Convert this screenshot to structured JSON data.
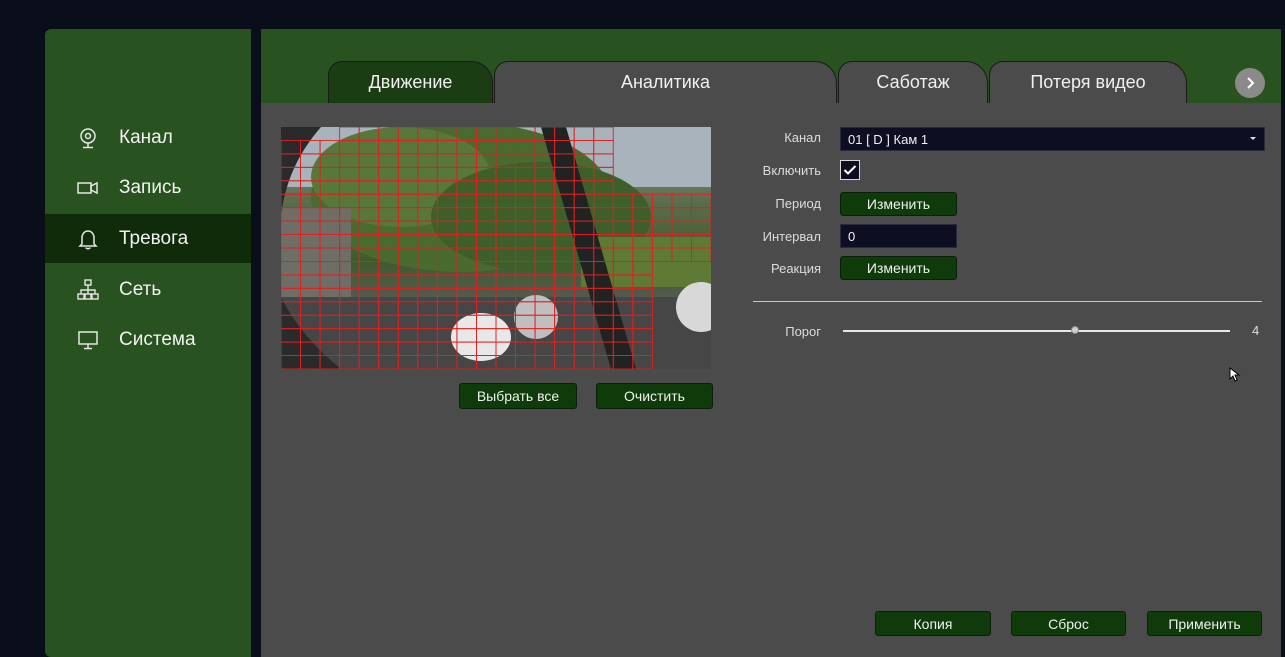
{
  "sidebar": {
    "items": [
      {
        "label": "Канал",
        "icon": "camera-icon",
        "active": false
      },
      {
        "label": "Запись",
        "icon": "video-record-icon",
        "active": false
      },
      {
        "label": "Тревога",
        "icon": "bell-icon",
        "active": true
      },
      {
        "label": "Сеть",
        "icon": "network-icon",
        "active": false
      },
      {
        "label": "Система",
        "icon": "monitor-icon",
        "active": false
      }
    ]
  },
  "tabs": [
    {
      "label": "Движение",
      "active": true
    },
    {
      "label": "Аналитика",
      "active": false
    },
    {
      "label": "Саботаж",
      "active": false
    },
    {
      "label": "Потеря видео",
      "active": false
    }
  ],
  "preview": {
    "select_all_label": "Выбрать все",
    "clear_label": "Очистить"
  },
  "form": {
    "channel_label": "Канал",
    "channel_value": "01 [ D ] Кам 1",
    "enable_label": "Включить",
    "enable_checked": true,
    "period_label": "Период",
    "period_button": "Изменить",
    "interval_label": "Интервал",
    "interval_value": "0",
    "reaction_label": "Реакция",
    "reaction_button": "Изменить",
    "threshold_label": "Порог",
    "threshold_value": "4",
    "threshold_fraction": 0.6
  },
  "footer": {
    "copy_label": "Копия",
    "reset_label": "Сброс",
    "apply_label": "Применить"
  },
  "colors": {
    "panel_green": "#28521f",
    "active_dark": "#0f2b0a",
    "content_gray": "#4b4b4b",
    "grid_red": "#e02020"
  }
}
